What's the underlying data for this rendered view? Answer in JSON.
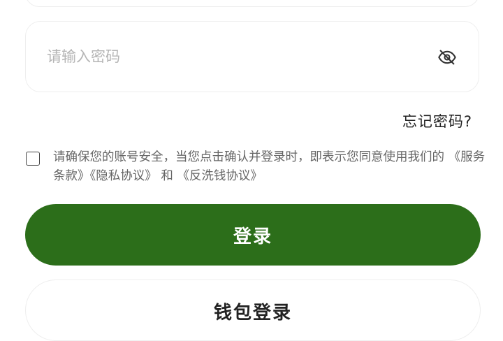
{
  "password": {
    "placeholder": "请输入密码",
    "value": "",
    "toggle_icon": "eye-off-icon"
  },
  "forgot_password_label": "忘记密码?",
  "agreement": {
    "checked": false,
    "text_prefix": "请确保您的账号安全，当您点击确认并登录时，即表示您同意使用我们的",
    "terms_label": "《服务条款》",
    "privacy_label": "《隐私协议》",
    "conjunction": "和",
    "aml_label": "《反洗钱协议》"
  },
  "login_button_label": "登录",
  "wallet_login_button_label": "钱包登录",
  "colors": {
    "primary_green": "#2c6e1a",
    "placeholder_gray": "#b5b5b5",
    "border_gray": "#eeeeee"
  }
}
